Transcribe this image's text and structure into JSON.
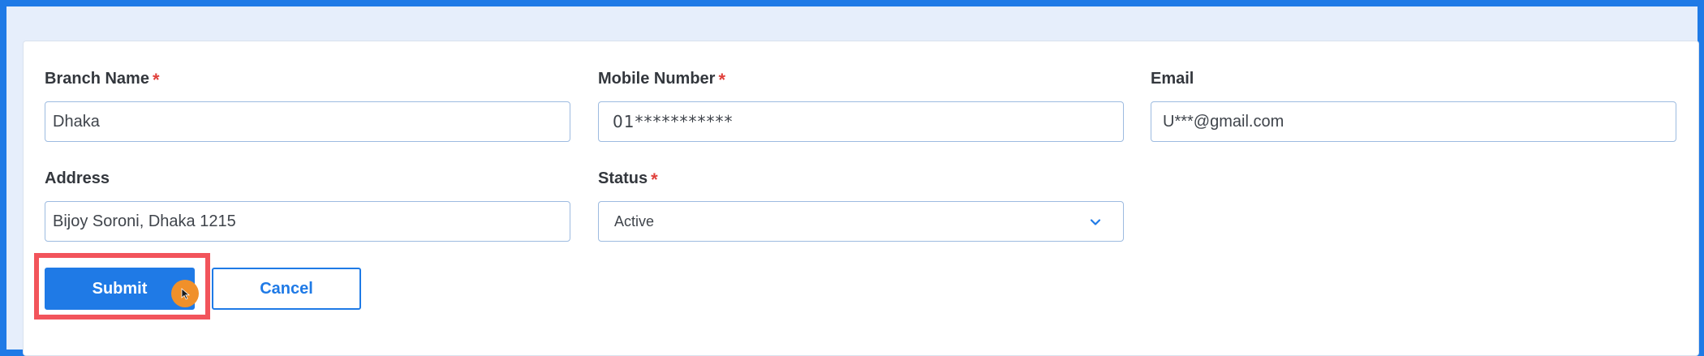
{
  "form": {
    "branch_name": {
      "label": "Branch Name",
      "required_mark": "*",
      "value": "Dhaka"
    },
    "mobile_number": {
      "label": "Mobile Number",
      "required_mark": "*",
      "value": "01***********"
    },
    "email": {
      "label": "Email",
      "value": "U***@gmail.com"
    },
    "address": {
      "label": "Address",
      "value": "Bijoy Soroni, Dhaka 1215"
    },
    "status": {
      "label": "Status",
      "required_mark": "*",
      "selected": "Active",
      "icon": "chevron-down-icon"
    }
  },
  "actions": {
    "submit_label": "Submit",
    "cancel_label": "Cancel"
  },
  "colors": {
    "accent": "#1f7ae6",
    "required": "#e0403b",
    "highlight": "#f2545b",
    "cursor": "#f0902a"
  }
}
